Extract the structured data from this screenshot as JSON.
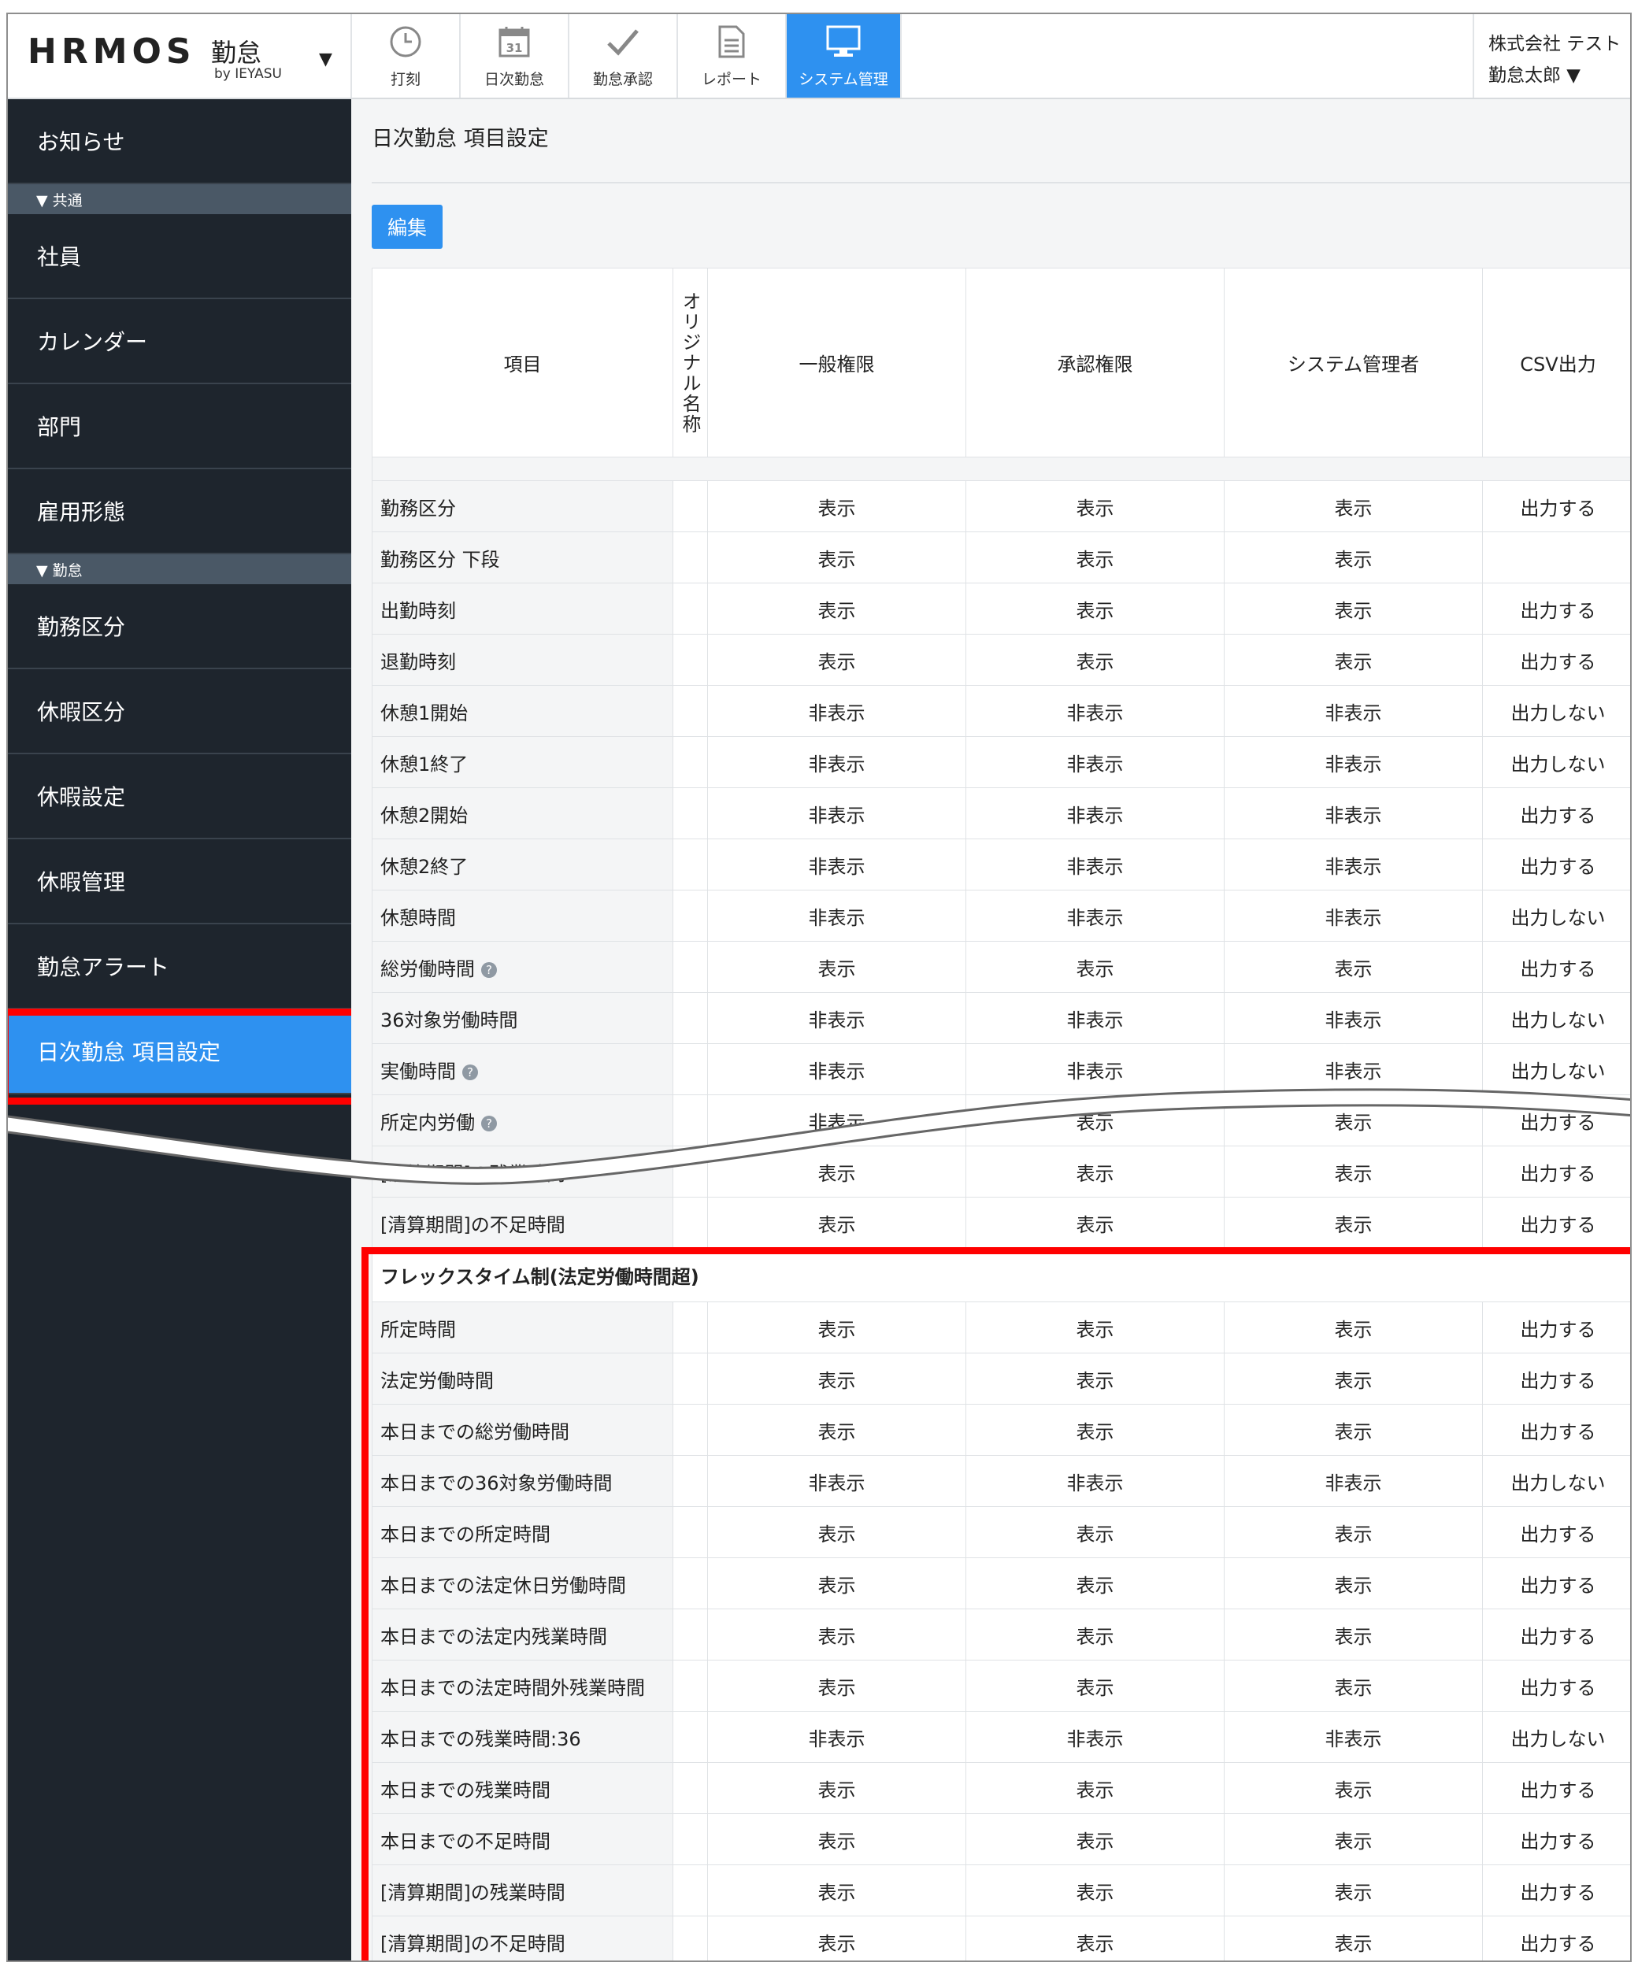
{
  "app": {
    "logo": "HRMOS",
    "logo_ja": "勤怠",
    "by": "by IEYASU"
  },
  "nav": [
    {
      "label": "打刻",
      "icon": "clock-icon"
    },
    {
      "label": "日次勤怠",
      "icon": "calendar-icon"
    },
    {
      "label": "勤怠承認",
      "icon": "check-icon"
    },
    {
      "label": "レポート",
      "icon": "document-icon"
    },
    {
      "label": "システム管理",
      "icon": "monitor-icon",
      "active": true
    }
  ],
  "calendar_day": "31",
  "user": {
    "company": "株式会社 テスト",
    "name": "勤怠太郎 ▼"
  },
  "sidebar": {
    "top_item": "お知らせ",
    "section1": "▼ 共通",
    "common": [
      "社員",
      "カレンダー",
      "部門",
      "雇用形態"
    ],
    "section2": "▼ 勤怠",
    "attendance": [
      "勤務区分",
      "休暇区分",
      "休暇設定",
      "休暇管理",
      "勤怠アラート",
      "日次勤怠 項目設定"
    ]
  },
  "page": {
    "title": "日次勤怠 項目設定",
    "edit_button": "編集"
  },
  "table": {
    "headers": {
      "item": "項目",
      "original": "オリジナル名称",
      "general": "一般権限",
      "approve": "承認権限",
      "admin": "システム管理者",
      "csv": "CSV出力"
    },
    "rows": [
      {
        "name": "勤務区分",
        "g": "表示",
        "a": "表示",
        "s": "表示",
        "c": "出力する"
      },
      {
        "name": "勤務区分 下段",
        "g": "表示",
        "a": "表示",
        "s": "表示",
        "c": ""
      },
      {
        "name": "出勤時刻",
        "g": "表示",
        "a": "表示",
        "s": "表示",
        "c": "出力する"
      },
      {
        "name": "退勤時刻",
        "g": "表示",
        "a": "表示",
        "s": "表示",
        "c": "出力する"
      },
      {
        "name": "休憩1開始",
        "g": "非表示",
        "a": "非表示",
        "s": "非表示",
        "c": "出力しない"
      },
      {
        "name": "休憩1終了",
        "g": "非表示",
        "a": "非表示",
        "s": "非表示",
        "c": "出力しない"
      },
      {
        "name": "休憩2開始",
        "g": "非表示",
        "a": "非表示",
        "s": "非表示",
        "c": "出力する"
      },
      {
        "name": "休憩2終了",
        "g": "非表示",
        "a": "非表示",
        "s": "非表示",
        "c": "出力する"
      },
      {
        "name": "休憩時間",
        "g": "非表示",
        "a": "非表示",
        "s": "非表示",
        "c": "出力しない"
      },
      {
        "name": "総労働時間",
        "help": true,
        "g": "表示",
        "a": "表示",
        "s": "表示",
        "c": "出力する"
      },
      {
        "name": "36対象労働時間",
        "g": "非表示",
        "a": "非表示",
        "s": "非表示",
        "c": "出力しない"
      },
      {
        "name": "実働時間",
        "help": true,
        "g": "非表示",
        "a": "非表示",
        "s": "非表示",
        "c": "出力しない"
      },
      {
        "name": "所定内労働",
        "help": true,
        "g": "非表示",
        "a": "表示",
        "s": "表示",
        "c": "出力する"
      },
      {
        "name": "[清算期間]の残業時間",
        "g": "表示",
        "a": "表示",
        "s": "表示",
        "c": "出力する"
      },
      {
        "name": "[清算期間]の不足時間",
        "g": "表示",
        "a": "表示",
        "s": "表示",
        "c": "出力する"
      }
    ],
    "section_title": "フレックスタイム制(法定労働時間超)",
    "flex_rows": [
      {
        "name": "所定時間",
        "g": "表示",
        "a": "表示",
        "s": "表示",
        "c": "出力する"
      },
      {
        "name": "法定労働時間",
        "g": "表示",
        "a": "表示",
        "s": "表示",
        "c": "出力する"
      },
      {
        "name": "本日までの総労働時間",
        "g": "表示",
        "a": "表示",
        "s": "表示",
        "c": "出力する"
      },
      {
        "name": "本日までの36対象労働時間",
        "g": "非表示",
        "a": "非表示",
        "s": "非表示",
        "c": "出力しない"
      },
      {
        "name": "本日までの所定時間",
        "g": "表示",
        "a": "表示",
        "s": "表示",
        "c": "出力する"
      },
      {
        "name": "本日までの法定休日労働時間",
        "g": "表示",
        "a": "表示",
        "s": "表示",
        "c": "出力する"
      },
      {
        "name": "本日までの法定内残業時間",
        "g": "表示",
        "a": "表示",
        "s": "表示",
        "c": "出力する"
      },
      {
        "name": "本日までの法定時間外残業時間",
        "g": "表示",
        "a": "表示",
        "s": "表示",
        "c": "出力する"
      },
      {
        "name": "本日までの残業時間:36",
        "g": "非表示",
        "a": "非表示",
        "s": "非表示",
        "c": "出力しない"
      },
      {
        "name": "本日までの残業時間",
        "g": "表示",
        "a": "表示",
        "s": "表示",
        "c": "出力する"
      },
      {
        "name": "本日までの不足時間",
        "g": "表示",
        "a": "表示",
        "s": "表示",
        "c": "出力する"
      },
      {
        "name": "[清算期間]の残業時間",
        "g": "表示",
        "a": "表示",
        "s": "表示",
        "c": "出力する"
      },
      {
        "name": "[清算期間]の不足時間",
        "g": "表示",
        "a": "表示",
        "s": "表示",
        "c": "出力する"
      }
    ]
  },
  "colors": {
    "accent": "#2e91f0",
    "sidebar": "#1e252d",
    "highlight": "#ff0000"
  }
}
